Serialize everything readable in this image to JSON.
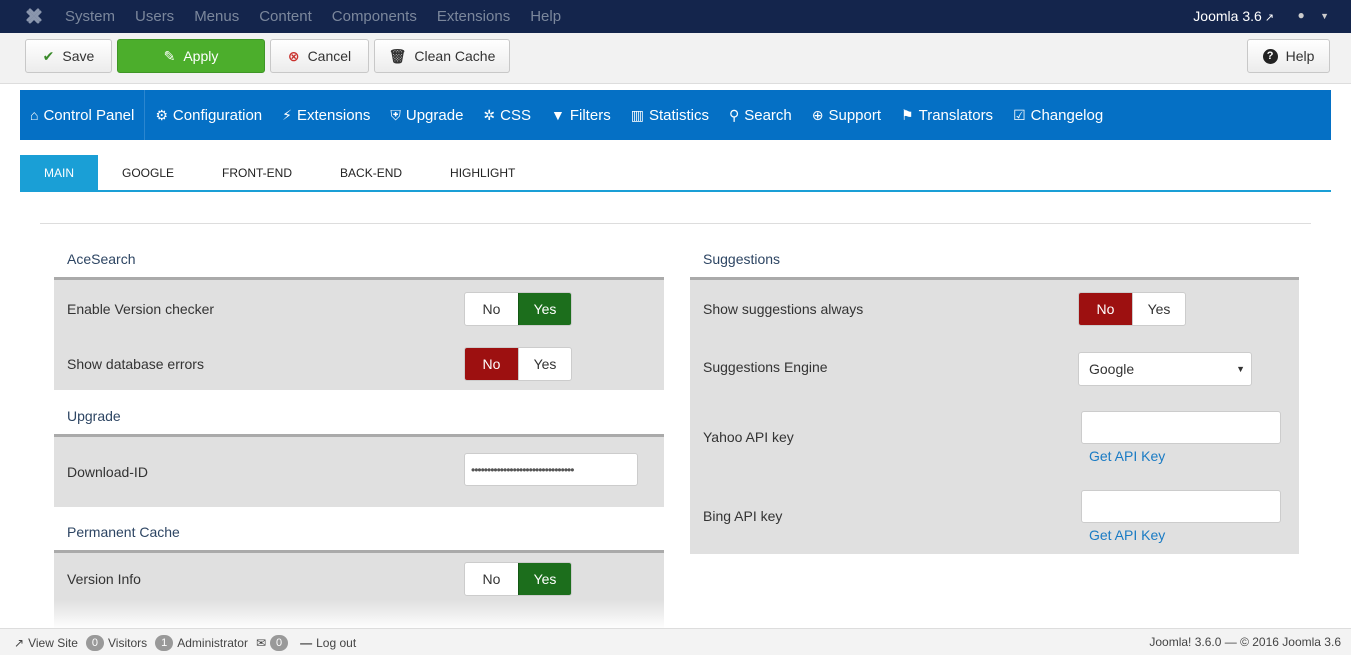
{
  "navbar": {
    "menu": [
      "System",
      "Users",
      "Menus",
      "Content",
      "Components",
      "Extensions",
      "Help"
    ],
    "brand": "Joomla 3.6",
    "user_icon": "user-icon"
  },
  "toolbar": {
    "save": "Save",
    "apply": "Apply",
    "cancel": "Cancel",
    "clean_cache": "Clean Cache",
    "help": "Help"
  },
  "compnav": {
    "items": [
      {
        "label": "Control Panel",
        "icon": "home-icon"
      },
      {
        "label": "Configuration",
        "icon": "cogs-icon"
      },
      {
        "label": "Extensions",
        "icon": "plug-icon"
      },
      {
        "label": "Upgrade",
        "icon": "shield-icon"
      },
      {
        "label": "CSS",
        "icon": "magic-icon"
      },
      {
        "label": "Filters",
        "icon": "filter-icon"
      },
      {
        "label": "Statistics",
        "icon": "bar-chart-icon"
      },
      {
        "label": "Search",
        "icon": "search-icon"
      },
      {
        "label": "Support",
        "icon": "lifebuoy-icon"
      },
      {
        "label": "Translators",
        "icon": "flag-icon"
      },
      {
        "label": "Changelog",
        "icon": "clipboard-icon"
      }
    ]
  },
  "tabs": [
    "MAIN",
    "GOOGLE",
    "FRONT-END",
    "BACK-END",
    "HIGHLIGHT"
  ],
  "acesearch": {
    "title": "AceSearch",
    "version_checker": {
      "label": "Enable Version checker",
      "value": "Yes"
    },
    "db_errors": {
      "label": "Show database errors",
      "value": "No"
    }
  },
  "upgrade": {
    "title": "Upgrade",
    "download_id": {
      "label": "Download-ID",
      "value": "••••••••••••••••••••••••••••••••"
    }
  },
  "permanent_cache": {
    "title": "Permanent Cache",
    "version_info": {
      "label": "Version Info",
      "value": "Yes"
    }
  },
  "suggestions": {
    "title": "Suggestions",
    "show_always": {
      "label": "Show suggestions always",
      "value": "No"
    },
    "engine": {
      "label": "Suggestions Engine",
      "value": "Google"
    },
    "yahoo": {
      "label": "Yahoo API key",
      "value": "",
      "link": "Get API Key"
    },
    "bing": {
      "label": "Bing API key",
      "value": "",
      "link": "Get API Key"
    }
  },
  "yesno": {
    "no": "No",
    "yes": "Yes"
  },
  "status": {
    "view_site": "View Site",
    "visitors_count": "0",
    "visitors": "Visitors",
    "admins_count": "1",
    "admins": "Administrator",
    "messages_count": "0",
    "logout": "Log out",
    "footer": "Joomla! 3.6.0 — © 2016 Joomla 3.6"
  }
}
